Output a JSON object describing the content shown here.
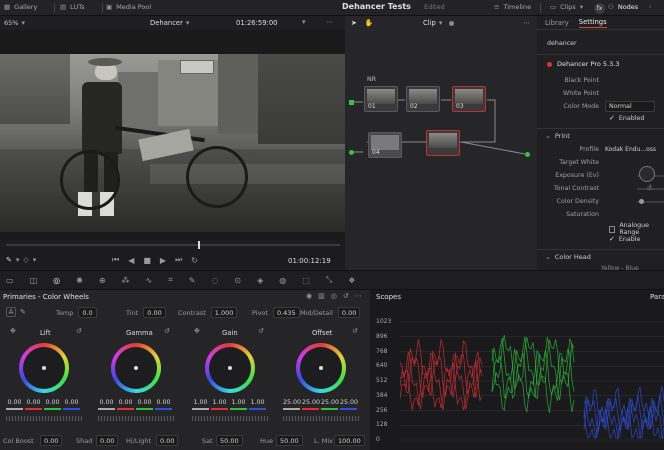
{
  "topbar": {
    "gallery": "Gallery",
    "luts": "LUTs",
    "media_pool": "Media Pool",
    "project_title": "Dehancer Tests",
    "project_status": "Edited",
    "timeline": "Timeline",
    "clips": "Clips",
    "nodes": "Nodes",
    "fx": "fx"
  },
  "viewer": {
    "zoom": "65%",
    "clip_name": "Dehancer",
    "timecode_top": "01:26:59:00",
    "timecode_bottom": "01:00:12:19"
  },
  "node_editor": {
    "mode": "Clip",
    "label_nr": "NR",
    "nodes": [
      {
        "num": "01"
      },
      {
        "num": "02"
      },
      {
        "num": "03"
      },
      {
        "num": "04"
      },
      {
        "num": "05"
      }
    ]
  },
  "inspector": {
    "tabs": [
      "Library",
      "Settings"
    ],
    "active_tab": "Settings",
    "plugin_search": "dehancer",
    "plugin_name": "Dehancer Pro 5.3.3",
    "rows": [
      {
        "key": "Black Point",
        "value": ""
      },
      {
        "key": "White Point",
        "value": ""
      },
      {
        "key": "Color Mode",
        "value": "Normal"
      }
    ],
    "enabled_label": "Enabled",
    "print_section": "Print",
    "profile_key": "Profile",
    "profile_value": "Kodak Endu...oss",
    "print_rows": [
      "Target White",
      "Exposure (Ev)",
      "Tonal Contrast",
      "Color Density",
      "Saturation"
    ],
    "analogue_range": "Analogue Range",
    "enable_label": "Enable",
    "color_head_section": "Color Head",
    "yellow_blue": "Yellow - Blue"
  },
  "wheels_panel": {
    "title": "Primaries - Color Wheels",
    "temp_label": "Temp",
    "temp_value": "0.0",
    "tint_label": "Tint",
    "tint_value": "0.00",
    "contrast_label": "Contrast",
    "contrast_value": "1.000",
    "pivot_label": "Pivot",
    "pivot_value": "0.435",
    "middetail_label": "Mid/Detail",
    "middetail_value": "0.00",
    "wheels": [
      {
        "name": "Lift",
        "values": [
          "0.00",
          "0.00",
          "0.00",
          "0.00"
        ]
      },
      {
        "name": "Gamma",
        "values": [
          "0.00",
          "0.00",
          "0.00",
          "0.00"
        ]
      },
      {
        "name": "Gain",
        "values": [
          "1.00",
          "1.00",
          "1.00",
          "1.00"
        ]
      },
      {
        "name": "Offset",
        "values": [
          "25.00",
          "25.00",
          "25.00",
          "25.00"
        ]
      }
    ],
    "colboost_label": "Col Boost",
    "colboost_value": "0.00",
    "shad_label": "Shad",
    "shad_value": "0.00",
    "hilight_label": "Hi/Light",
    "hilight_value": "0.00",
    "sat_label": "Sat",
    "sat_value": "50.00",
    "hue_label": "Hue",
    "hue_value": "50.00",
    "lmix_label": "L. Mix",
    "lmix_value": "100.00"
  },
  "scopes": {
    "title": "Scopes",
    "mode": "Para",
    "scale": [
      "1023",
      "896",
      "768",
      "640",
      "512",
      "384",
      "256",
      "128",
      "0"
    ]
  },
  "colors": {
    "accent_red": "#e0303a",
    "tab_underline": "#e04040"
  }
}
